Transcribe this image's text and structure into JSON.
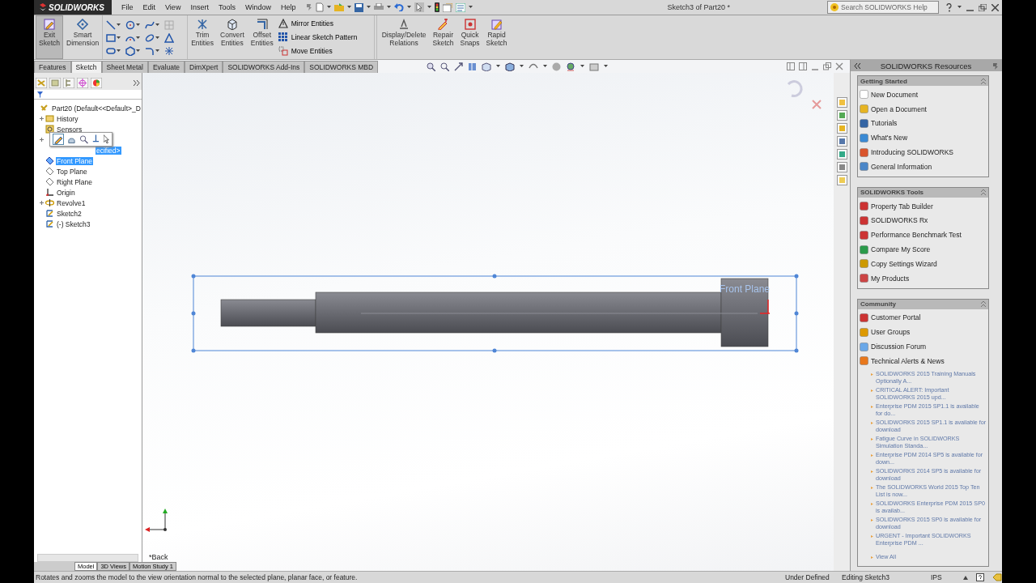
{
  "app": {
    "logo": "SOLIDWORKS",
    "title": "Sketch3 of Part20 *"
  },
  "menu": [
    "File",
    "Edit",
    "View",
    "Insert",
    "Tools",
    "Window",
    "Help"
  ],
  "search": {
    "placeholder": "Search SOLIDWORKS Help"
  },
  "command_manager": [
    {
      "kind": "large",
      "label": "Exit Sketch",
      "selected": true
    },
    {
      "kind": "large",
      "label": "Smart Dimension",
      "selected": false
    },
    {
      "kind": "grid"
    },
    {
      "kind": "large",
      "label": "Trim Entities",
      "selected": false
    },
    {
      "kind": "large",
      "label": "Convert Entities",
      "selected": false
    },
    {
      "kind": "large",
      "label": "Offset Entities",
      "selected": false
    },
    {
      "kind": "stack",
      "items": [
        "Mirror Entities",
        "Linear Sketch Pattern",
        "Move Entities"
      ]
    },
    {
      "kind": "large",
      "label": "Display/Delete Relations",
      "selected": false
    },
    {
      "kind": "large",
      "label": "Repair Sketch",
      "selected": false
    },
    {
      "kind": "large",
      "label": "Quick Snaps",
      "selected": false
    },
    {
      "kind": "large",
      "label": "Rapid Sketch",
      "selected": false
    }
  ],
  "tabs": [
    {
      "label": "Features",
      "selected": false
    },
    {
      "label": "Sketch",
      "selected": true
    },
    {
      "label": "Sheet Metal",
      "selected": false
    },
    {
      "label": "Evaluate",
      "selected": false
    },
    {
      "label": "DimXpert",
      "selected": false
    },
    {
      "label": "SOLIDWORKS Add-Ins",
      "selected": false
    },
    {
      "label": "SOLIDWORKS MBD",
      "selected": false
    }
  ],
  "tree": {
    "label": "Part20  (Default<<Default>_D",
    "children": [
      {
        "kind": "item",
        "label": "History",
        "expandable": true,
        "selected": false
      },
      {
        "kind": "item",
        "label": "Sensors",
        "expandable": false,
        "selected": false
      },
      {
        "kind": "covered",
        "expandable": true
      },
      {
        "kind": "partial",
        "label": "ecified>",
        "selected": true
      },
      {
        "kind": "item",
        "label": "Front Plane",
        "expandable": false,
        "selected": true
      },
      {
        "kind": "item",
        "label": "Top Plane",
        "expandable": false,
        "selected": false
      },
      {
        "kind": "item",
        "label": "Right Plane",
        "expandable": false,
        "selected": false
      },
      {
        "kind": "item",
        "label": "Origin",
        "expandable": false,
        "selected": false
      },
      {
        "kind": "item",
        "label": "Revolve1",
        "expandable": true,
        "selected": false
      },
      {
        "kind": "item",
        "label": "Sketch2",
        "expandable": false,
        "selected": false
      },
      {
        "kind": "item",
        "label": "(-) Sketch3",
        "expandable": false,
        "selected": false
      }
    ]
  },
  "bottom_tabs": [
    {
      "label": "Model",
      "selected": true
    },
    {
      "label": "3D Views",
      "selected": false
    },
    {
      "label": "Motion Study 1",
      "selected": false
    }
  ],
  "viewport": {
    "plane_label": "Front Plane",
    "view_label": "*Back"
  },
  "task_pane": {
    "title": "SOLIDWORKS Resources",
    "sections": [
      {
        "title": "Getting Started",
        "items": [
          "New Document",
          "Open a Document",
          "Tutorials",
          "What's New",
          "Introducing SOLIDWORKS",
          "General Information"
        ]
      },
      {
        "title": "SOLIDWORKS Tools",
        "items": [
          "Property Tab Builder",
          "SOLIDWORKS Rx",
          "Performance Benchmark Test",
          "Compare My Score",
          "Copy Settings Wizard",
          "My Products"
        ]
      },
      {
        "title": "Community",
        "items": [
          "Customer Portal",
          "User Groups",
          "Discussion Forum",
          "Technical Alerts & News"
        ],
        "news": [
          "SOLIDWORKS 2015 Training Manuals Optionally A...",
          "CRITICAL ALERT: Important SOLIDWORKS 2015 upd...",
          "Enterprise PDM 2015 SP1.1 is available for do...",
          "SOLIDWORKS 2015 SP1.1 is available for download",
          "Fatigue Curve in SOLIDWORKS Simulation Standa...",
          "Enterprise PDM 2014 SP5 is available for down...",
          "SOLIDWORKS 2014 SP5 is available for download",
          "The SOLIDWORKS World 2015 Top Ten List is now...",
          "SOLIDWORKS Enterprise PDM 2015 SP0 is availab...",
          "SOLIDWORKS 2015 SP0 is available for download",
          "URGENT - Important SOLIDWORKS Enterprise PDM ..."
        ],
        "view_all": "View All"
      }
    ]
  },
  "status_bar": {
    "message": "Rotates and zooms the model to the view orientation normal to the selected plane, planar face, or feature.",
    "state": "Under Defined",
    "editing": "Editing Sketch3",
    "units": "IPS"
  }
}
